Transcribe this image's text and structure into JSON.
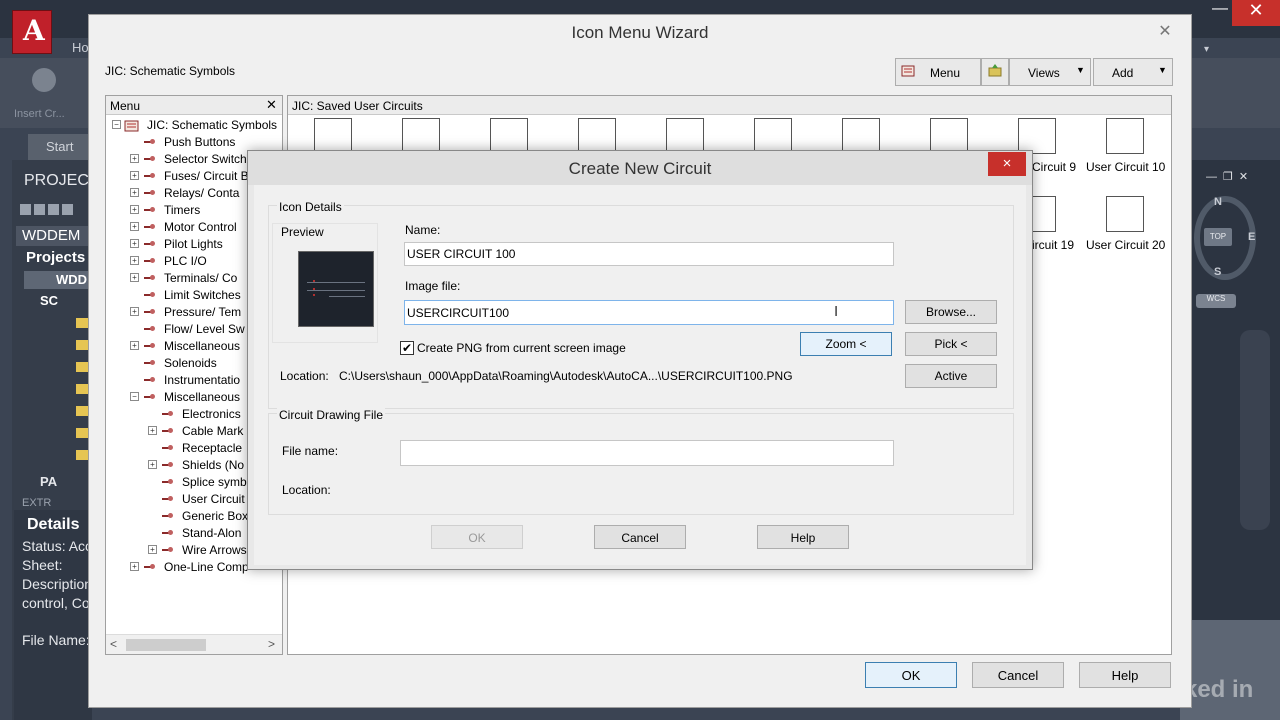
{
  "background": {
    "ribbon_tab": "Ho",
    "insert_label": "Insert Cr...",
    "start_tab": "Start",
    "project_header": "PROJECT",
    "project_name_short": "WDDEM",
    "projects_label": "Projects",
    "project_row": "WDD",
    "sub_folder": "SC",
    "pa_folder": "PA",
    "ext_row": "EXTR",
    "details_title": "Details",
    "status_text": "Status: Acc",
    "sheet_text": "Sheet:",
    "description_text": "Description",
    "control_text": "control, Co",
    "file_name_text": "File Name:",
    "viewcube": {
      "n": "N",
      "e": "E",
      "s": "S",
      "top": "TOP",
      "wcs": "WCS"
    },
    "watermark": "Linked in"
  },
  "wizard": {
    "title": "Icon Menu Wizard",
    "menu_title": "JIC: Schematic Symbols",
    "toolbar": {
      "menu": "Menu",
      "views": "Views",
      "add": "Add"
    },
    "menu_panel": {
      "header": "Menu",
      "items": [
        {
          "label": "JIC: Schematic Symbols"
        },
        {
          "label": "Push Buttons"
        },
        {
          "label": "Selector Switch"
        },
        {
          "label": "Fuses/ Circuit B"
        },
        {
          "label": "Relays/ Conta"
        },
        {
          "label": "Timers"
        },
        {
          "label": "Motor Control"
        },
        {
          "label": "Pilot Lights"
        },
        {
          "label": "PLC I/O"
        },
        {
          "label": "Terminals/ Co"
        },
        {
          "label": "Limit Switches"
        },
        {
          "label": "Pressure/ Tem"
        },
        {
          "label": "Flow/ Level Sw"
        },
        {
          "label": "Miscellaneous"
        },
        {
          "label": "Solenoids"
        },
        {
          "label": "Instrumentatio"
        },
        {
          "label": "Miscellaneous"
        },
        {
          "label": "Electronics"
        },
        {
          "label": "Cable Mark"
        },
        {
          "label": "Receptacle"
        },
        {
          "label": "Shields (No"
        },
        {
          "label": "Splice symb"
        },
        {
          "label": "User Circuit"
        },
        {
          "label": "Generic Box"
        },
        {
          "label": "Stand-Alon"
        },
        {
          "label": "Wire Arrows"
        },
        {
          "label": "One-Line Comp"
        }
      ]
    },
    "saved_panel": {
      "header": "JIC: Saved User Circuits",
      "row1_labels": [
        "Circuit 9",
        "User Circuit 10"
      ],
      "row2_labels": [
        "ircuit 19",
        "User Circuit 20"
      ]
    },
    "buttons": {
      "ok": "OK",
      "cancel": "Cancel",
      "help": "Help"
    }
  },
  "dialog": {
    "title": "Create New Circuit",
    "close": "×",
    "icon_details_label": "Icon Details",
    "preview_label": "Preview",
    "name_label": "Name:",
    "name_value": "USER CIRCUIT 100",
    "image_file_label": "Image file:",
    "image_file_value": "USERCIRCUIT100",
    "browse": "Browse...",
    "zoom": "Zoom <",
    "pick": "Pick <",
    "active": "Active",
    "png_checkbox_label": "Create PNG from current screen image",
    "png_checked": true,
    "location_label": "Location:",
    "location_value": "C:\\Users\\shaun_000\\AppData\\Roaming\\Autodesk\\AutoCA...\\USERCIRCUIT100.PNG",
    "drawing_group_label": "Circuit Drawing File",
    "file_name_label": "File name:",
    "file_name_value": "",
    "location2_label": "Location:",
    "ok": "OK",
    "cancel": "Cancel",
    "help": "Help"
  },
  "colors": {
    "close_red": "#c7302b",
    "focus_blue": "#3c7fb1",
    "acad_dark": "#3b4453"
  }
}
